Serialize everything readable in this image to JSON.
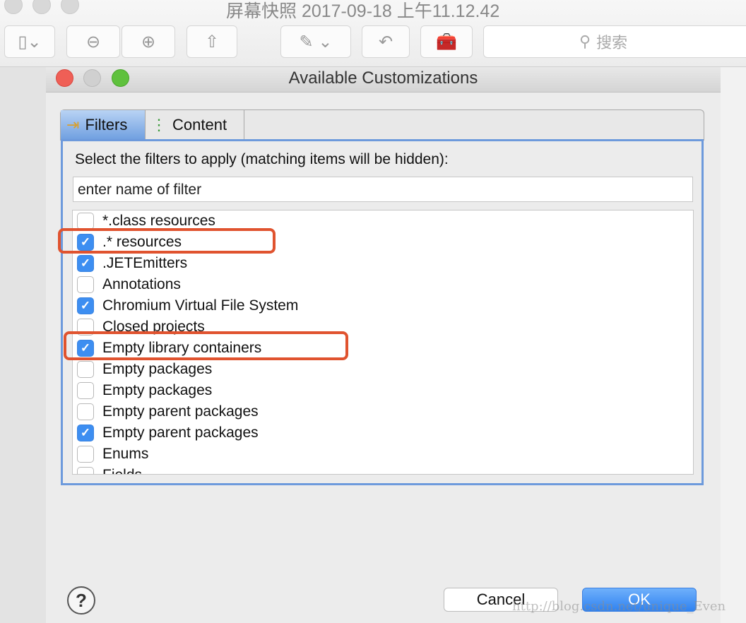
{
  "preview_window": {
    "title": "屏幕快照 2017-09-18 上午11.12.42",
    "search_placeholder": "搜索",
    "toolbar_icons": [
      "sidebar-icon",
      "zoom-out-icon",
      "zoom-in-icon",
      "share-icon",
      "markup-icon",
      "rotate-icon",
      "toolbox-icon"
    ]
  },
  "dialog": {
    "title": "Available Customizations",
    "tabs": [
      {
        "label": "Filters",
        "active": true
      },
      {
        "label": "Content",
        "active": false
      }
    ],
    "instruction": "Select the filters to apply (matching items will be hidden):",
    "filter_input": {
      "placeholder": "enter name of filter"
    },
    "filters": [
      {
        "label": "*.class resources",
        "checked": false,
        "highlighted": false
      },
      {
        "label": ".* resources",
        "checked": true,
        "highlighted": true
      },
      {
        "label": ".JETEmitters",
        "checked": true,
        "highlighted": false
      },
      {
        "label": "Annotations",
        "checked": false,
        "highlighted": false
      },
      {
        "label": "Chromium Virtual File System",
        "checked": true,
        "highlighted": false
      },
      {
        "label": "Closed projects",
        "checked": false,
        "highlighted": false
      },
      {
        "label": "Empty library containers",
        "checked": true,
        "highlighted": true
      },
      {
        "label": "Empty packages",
        "checked": false,
        "highlighted": false
      },
      {
        "label": "Empty packages",
        "checked": false,
        "highlighted": false
      },
      {
        "label": "Empty parent packages",
        "checked": false,
        "highlighted": false
      },
      {
        "label": "Empty parent packages",
        "checked": true,
        "highlighted": false
      },
      {
        "label": "Enums",
        "checked": false,
        "highlighted": false
      },
      {
        "label": "Fields",
        "checked": false,
        "highlighted": false
      }
    ],
    "help_label": "?",
    "cancel_label": "Cancel",
    "ok_label": "OK"
  },
  "watermark": "http://blog.csdn.net/unique_Even",
  "colors": {
    "accent": "#3d8ef1",
    "highlight": "#e0532f",
    "ok_button": "#3b86f2"
  }
}
